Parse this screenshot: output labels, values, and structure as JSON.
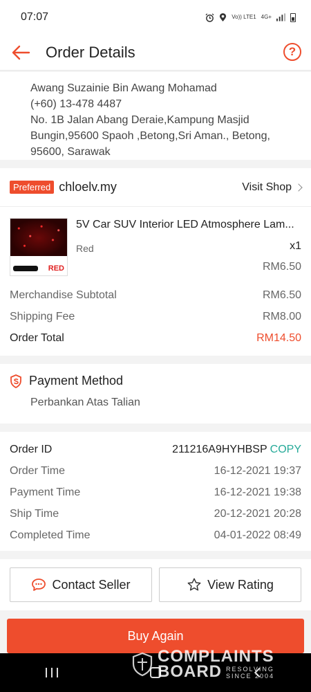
{
  "status_bar": {
    "time": "07:07",
    "network_top": "Vo)) LTE1",
    "network_4g": "4G+"
  },
  "header": {
    "title": "Order Details",
    "help_icon": "?"
  },
  "address": {
    "name": "Awang Suzainie Bin Awang Mohamad",
    "phone": "(+60) 13-478 4487",
    "line": "No. 1B Jalan Abang Deraie,Kampung Masjid Bungin,95600 Spaoh ,Betong,Sri Aman., Betong, 95600, Sarawak"
  },
  "shop": {
    "badge": "Preferred",
    "name": "chloelv.my",
    "visit_label": "Visit Shop"
  },
  "product": {
    "name": "5V Car SUV Interior LED Atmosphere Lam...",
    "variant": "Red",
    "quantity": "x1",
    "price": "RM6.50",
    "thumb_tag": "RED"
  },
  "totals": {
    "subtotal_label": "Merchandise Subtotal",
    "subtotal_value": "RM6.50",
    "shipping_label": "Shipping Fee",
    "shipping_value": "RM8.00",
    "total_label": "Order Total",
    "total_value": "RM14.50"
  },
  "payment": {
    "title": "Payment Method",
    "value": "Perbankan Atas Talian"
  },
  "order_info": {
    "id_label": "Order ID",
    "id_value": "211216A9HYHBSP",
    "copy_label": "COPY",
    "rows": [
      {
        "label": "Order Time",
        "value": "16-12-2021 19:37"
      },
      {
        "label": "Payment Time",
        "value": "16-12-2021 19:38"
      },
      {
        "label": "Ship Time",
        "value": "20-12-2021 20:28"
      },
      {
        "label": "Completed Time",
        "value": "04-01-2022 08:49"
      }
    ]
  },
  "actions": {
    "contact_label": "Contact Seller",
    "rating_label": "View Rating",
    "buy_again_label": "Buy Again"
  },
  "watermark": {
    "line1": "COMPLAINTS",
    "line2": "BOARD",
    "sub1": "RESOLVING",
    "sub2": "SINCE 2004"
  },
  "colors": {
    "accent": "#ee4d2d",
    "copy": "#26aa99"
  }
}
